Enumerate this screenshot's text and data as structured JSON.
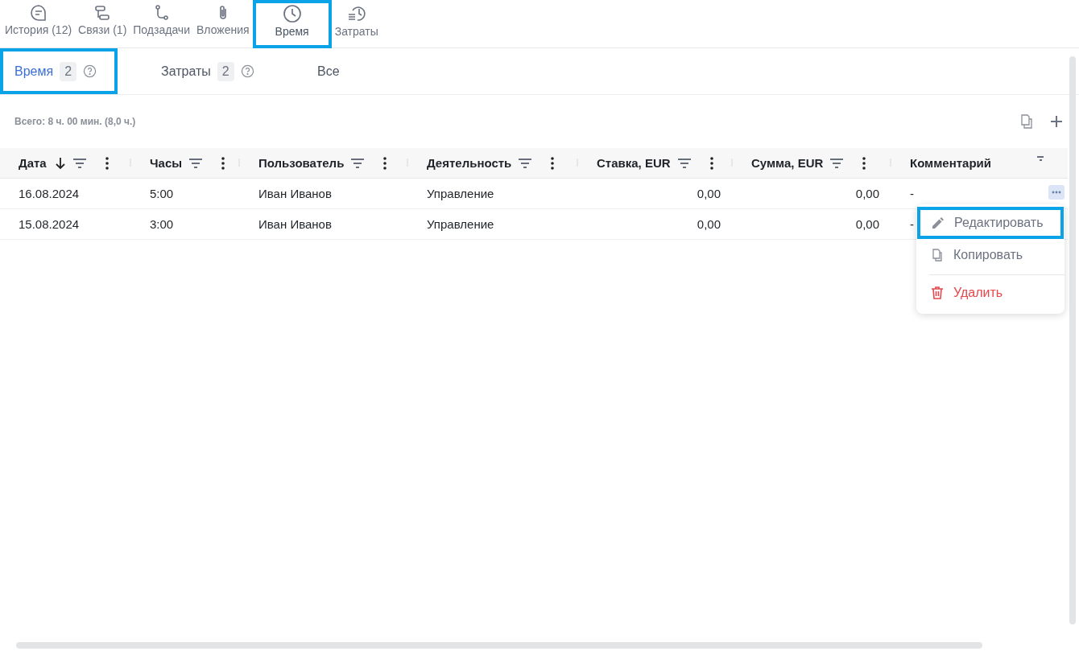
{
  "top_tabs": [
    {
      "label": "История (12)",
      "selected": false,
      "highlighted": false
    },
    {
      "label": "Связи (1)",
      "selected": false,
      "highlighted": false
    },
    {
      "label": "Подзадачи",
      "selected": false,
      "highlighted": false
    },
    {
      "label": "Вложения",
      "selected": false,
      "highlighted": false
    },
    {
      "label": "Время",
      "selected": true,
      "highlighted": true
    },
    {
      "label": "Затраты",
      "selected": false,
      "highlighted": false
    }
  ],
  "sub_tabs": [
    {
      "label": "Время",
      "count": "2",
      "help": true,
      "selected": true,
      "highlighted": true
    },
    {
      "label": "Затраты",
      "count": "2",
      "help": true,
      "selected": false,
      "highlighted": false
    },
    {
      "label": "Все",
      "help": false,
      "selected": false,
      "highlighted": false
    }
  ],
  "summary": "Всего: 8 ч. 00 мин. (8,0 ч.)",
  "table": {
    "columns": [
      {
        "label": "Дата",
        "sorted": true
      },
      {
        "label": "Часы",
        "sorted": false
      },
      {
        "label": "Пользователь",
        "sorted": false
      },
      {
        "label": "Деятельность",
        "sorted": false
      },
      {
        "label": "Ставка, EUR",
        "sorted": false
      },
      {
        "label": "Сумма, EUR",
        "sorted": false
      },
      {
        "label": "Комментарий",
        "sorted": false
      }
    ],
    "rows": [
      {
        "cells": [
          "16.08.2024",
          "5:00",
          "Иван Иванов",
          "Управление",
          "0,00",
          "0,00",
          "-"
        ],
        "menu_open": true
      },
      {
        "cells": [
          "15.08.2024",
          "3:00",
          "Иван Иванов",
          "Управление",
          "0,00",
          "0,00",
          "-"
        ],
        "menu_open": false
      }
    ]
  },
  "row_menu": {
    "items": [
      {
        "label": "Редактировать",
        "kind": "edit",
        "highlighted": true
      },
      {
        "label": "Копировать",
        "kind": "copy",
        "highlighted": false
      },
      {
        "label": "Удалить",
        "kind": "delete",
        "highlighted": false
      }
    ]
  }
}
